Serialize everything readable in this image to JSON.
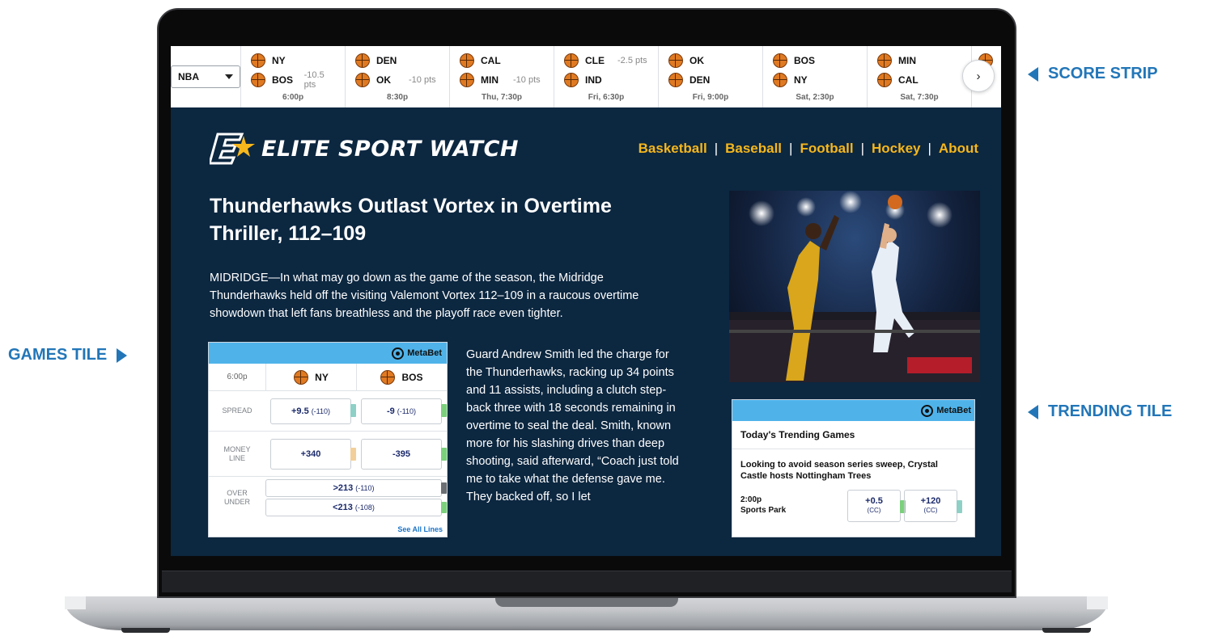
{
  "score_strip": {
    "league_value": "NBA",
    "games": [
      {
        "away": "NY",
        "home": "BOS",
        "away_spread": "",
        "home_spread": "-10.5 pts",
        "time": "6:00p"
      },
      {
        "away": "DEN",
        "home": "OK",
        "away_spread": "",
        "home_spread": "-10 pts",
        "time": "8:30p"
      },
      {
        "away": "CAL",
        "home": "MIN",
        "away_spread": "",
        "home_spread": "-10 pts",
        "time": "Thu, 7:30p"
      },
      {
        "away": "CLE",
        "home": "IND",
        "away_spread": "-2.5 pts",
        "home_spread": "",
        "time": "Fri, 6:30p"
      },
      {
        "away": "OK",
        "home": "DEN",
        "away_spread": "",
        "home_spread": "",
        "time": "Fri,  9:00p"
      },
      {
        "away": "BOS",
        "home": "NY",
        "away_spread": "",
        "home_spread": "",
        "time": "Sat, 2:30p"
      },
      {
        "away": "MIN",
        "home": "CAL",
        "away_spread": "",
        "home_spread": "",
        "time": "Sat, 7:30p"
      }
    ],
    "next_label": "›"
  },
  "site": {
    "name": "ELITE SPORT WATCH",
    "nav": [
      "Basketball",
      "Baseball",
      "Football",
      "Hockey",
      "About"
    ],
    "nav_separator": "|"
  },
  "article": {
    "headline": "Thunderhawks Outlast Vortex in Overtime Thriller, 112–109",
    "lede": "MIDRIDGE—In what may go down as the game of the season, the Midridge Thunderhawks held off the visiting Valemont Vortex 112–109 in a raucous overtime showdown that left fans breathless and the playoff race even tighter.",
    "body": "Guard Andrew Smith led the charge for the Thunderhawks, racking up 34 points and 11 assists, including a clutch step-back three with 18 seconds remaining in overtime to seal the deal. Smith, known more for his slashing drives than deep shooting, said afterward, “Coach just told me to take what the defense gave me. They backed off, so I let"
  },
  "games_tile": {
    "brand": "MetaBet",
    "time": "6:00p",
    "team_away": "NY",
    "team_home": "BOS",
    "spread_label": "SPREAD",
    "spread_away": "+9.5",
    "spread_away_odds": "(-110)",
    "spread_home": "-9",
    "spread_home_odds": "(-110)",
    "money_label_1": "MONEY",
    "money_label_2": "LINE",
    "money_away": "+340",
    "money_home": "-395",
    "ou_label_1": "OVER",
    "ou_label_2": "UNDER",
    "over": ">213",
    "over_odds": "(-110)",
    "under": "<213",
    "under_odds": "(-108)",
    "see_all": "See All Lines"
  },
  "trending_tile": {
    "brand": "MetaBet",
    "title": "Today's Trending Games",
    "story": "Looking to avoid season series sweep, Crystal Castle hosts Nottingham Trees",
    "time": "2:00p",
    "venue": "Sports Park",
    "line1": "+0.5",
    "line1_book": "(CC)",
    "line2": "+120",
    "line2_book": "(CC)"
  },
  "callouts": {
    "score_strip": "SCORE STRIP",
    "games_tile": "GAMES TILE",
    "trending_tile": "TRENDING TILE"
  },
  "colors": {
    "screen_bg": "#0c2740",
    "nav_accent": "#f6b71c",
    "tile_header": "#4fb3ea",
    "callout": "#2276b8",
    "odds_text": "#1b2a6b"
  },
  "icons": [
    "basketball-icon",
    "chevron-right-icon",
    "metabet-logo-icon",
    "dropdown-caret-icon",
    "sportsbook-tag-icon"
  ]
}
